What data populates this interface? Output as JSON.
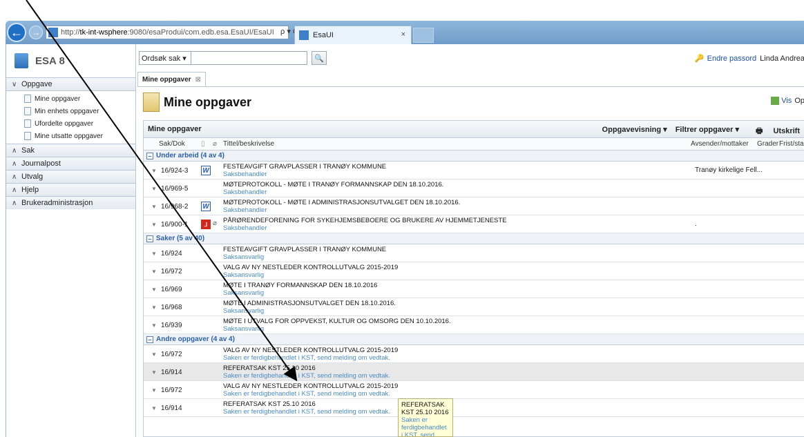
{
  "browser": {
    "url_prefix": "http://",
    "url_host": "tk-int-wsphere",
    "url_rest": ":9080/esaProdui/com.edb.esa.EsaUI/EsaUI",
    "url_icons": "ρ ▾ C",
    "tab_title": "EsaUI",
    "tab_close": "×"
  },
  "sidebar": {
    "logo": "ESA 8",
    "groups": [
      {
        "label": "Oppgave",
        "expanded": true
      },
      {
        "label": "Sak"
      },
      {
        "label": "Journalpost"
      },
      {
        "label": "Utvalg"
      },
      {
        "label": "Hjelp"
      },
      {
        "label": "Brukeradministrasjon"
      }
    ],
    "oppgave_items": [
      "Mine oppgaver",
      "Min enhets oppgaver",
      "Ufordelte oppgaver",
      "Mine utsatte oppgaver"
    ]
  },
  "topbar": {
    "search_type": "Ordsøk sak ▾",
    "search_value": "",
    "change_password": "Endre passord",
    "user": "Linda Andrea"
  },
  "main_tab": {
    "label": "Mine oppgaver",
    "close": "⊠"
  },
  "page": {
    "title": "Mine oppgaver",
    "vis": "Vis",
    "op": "Op"
  },
  "panel": {
    "title": "Mine oppgaver",
    "tools": [
      "Oppgavevisning ▾",
      "Filtrer oppgaver ▾",
      "Utskrift"
    ],
    "columns": [
      "Sak/Dok",
      "Tittel/beskrivelse",
      "Avsender/mottaker",
      "Grader",
      "Frist/starte"
    ]
  },
  "groups": [
    {
      "label": "Under arbeid (4 av 4)",
      "rows": [
        {
          "id": "16/924-3",
          "icon": "word",
          "clip": false,
          "title": "FESTEAVGIFT GRAVPLASSER I TRANØY KOMMUNE",
          "sub": "Saksbehandler",
          "avs": "Tranøy kirkelige Fell..."
        },
        {
          "id": "16/969-5",
          "icon": "",
          "clip": false,
          "title": "MØTEPROTOKOLL - MØTE I TRANØY FORMANNSKAP DEN 18.10.2016.",
          "sub": "Saksbehandler",
          "avs": ""
        },
        {
          "id": "16/968-2",
          "icon": "word",
          "clip": false,
          "title": "MØTEPROTOKOLL - MØTE I ADMINISTRASJONSUTVALGET DEN 18.10.2016.",
          "sub": "Saksbehandler",
          "avs": ""
        },
        {
          "id": "16/900-1",
          "icon": "pdf",
          "clip": true,
          "title": "PÅRØRENDEFORENING FOR SYKEHJEMSBEBOERE OG BRUKERE AV HJEMMETJENESTE",
          "sub": "Saksbehandler",
          "avs": "."
        }
      ]
    },
    {
      "label": "Saker (5 av 40)",
      "rows": [
        {
          "id": "16/924",
          "icon": "",
          "clip": false,
          "title": "FESTEAVGIFT GRAVPLASSER I TRANØY KOMMUNE",
          "sub": "Saksansvarlig",
          "avs": ""
        },
        {
          "id": "16/972",
          "icon": "",
          "clip": false,
          "title": "VALG AV NY NESTLEDER KONTROLLUTVALG 2015-2019",
          "sub": "Saksansvarlig",
          "avs": ""
        },
        {
          "id": "16/969",
          "icon": "",
          "clip": false,
          "title": "MØTE I TRANØY FORMANNSKAP DEN 18.10.2016",
          "sub": "Saksansvarlig",
          "avs": ""
        },
        {
          "id": "16/968",
          "icon": "",
          "clip": false,
          "title": "MØTE I ADMINISTRASJONSUTVALGET DEN 18.10.2016.",
          "sub": "Saksansvarlig",
          "avs": ""
        },
        {
          "id": "16/939",
          "icon": "",
          "clip": false,
          "title": "MØTE I UTVALG FOR OPPVEKST, KULTUR OG OMSORG DEN 10.10.2016.",
          "sub": "Saksansvarlig",
          "avs": ""
        }
      ]
    },
    {
      "label": "Andre oppgaver (4 av 4)",
      "rows": [
        {
          "id": "16/972",
          "icon": "",
          "clip": false,
          "title": "VALG AV NY NESTLEDER KONTROLLUTVALG 2015-2019",
          "sub": "Saken er ferdigbehandlet i KST, send melding om vedtak.",
          "avs": ""
        },
        {
          "id": "16/914",
          "icon": "",
          "clip": false,
          "hl": true,
          "title": "REFERATSAK KST 25.10 2016",
          "sub": "Saken er ferdigbehandlet i KST, send melding om vedtak.",
          "avs": ""
        },
        {
          "id": "16/972",
          "icon": "",
          "clip": false,
          "title": "VALG AV NY NESTLEDER KONTROLLUTVALG 2015-2019",
          "sub": "Saken er ferdigbehandlet i KST, send melding om vedtak.",
          "avs": ""
        },
        {
          "id": "16/914",
          "icon": "",
          "clip": false,
          "title": "REFERATSAK KST 25.10 2016",
          "sub": "Saken er ferdigbehandlet i KST, send melding om vedtak.",
          "avs": ""
        }
      ]
    }
  ],
  "tooltip": {
    "title": "REFERATSAK KST 25.10 2016",
    "text": "Saken er ferdigbehandlet i KST, send melding"
  },
  "colors": {
    "accent": "#2a5fa8",
    "sub_text": "#4a8ac6",
    "annotation_arrow": "#000000"
  }
}
